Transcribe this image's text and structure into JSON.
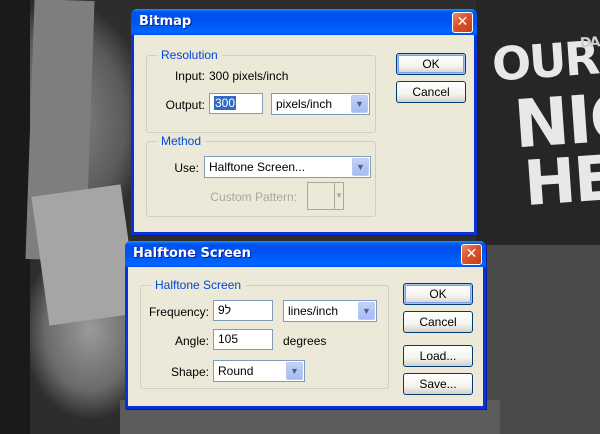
{
  "background": {
    "poster_text_1": "OUR",
    "poster_text_2": "NIG",
    "poster_text_3": "HE",
    "poster_text_4": "DA"
  },
  "bitmap": {
    "title": "Bitmap",
    "close_glyph": "✕",
    "resolution": {
      "legend": "Resolution",
      "input_label": "Input:",
      "input_value": "300 pixels/inch",
      "output_label": "Output:",
      "output_value": "300",
      "output_unit": "pixels/inch"
    },
    "method": {
      "legend": "Method",
      "use_label": "Use:",
      "use_value": "Halftone Screen...",
      "custom_pattern_label": "Custom Pattern:"
    },
    "ok_label": "OK",
    "cancel_label": "Cancel"
  },
  "halftone": {
    "title": "Halftone Screen",
    "close_glyph": "✕",
    "legend": "Halftone Screen",
    "frequency_label": "Frequency:",
    "frequency_value": "9ל",
    "frequency_unit": "lines/inch",
    "angle_label": "Angle:",
    "angle_value": "105",
    "angle_unit": "degrees",
    "shape_label": "Shape:",
    "shape_value": "Round",
    "ok_label": "OK",
    "cancel_label": "Cancel",
    "load_label": "Load...",
    "save_label": "Save..."
  },
  "colors": {
    "title_blue": "#0053ee",
    "legend_blue": "#0046d5",
    "dialog_face": "#ece9d8",
    "close_red": "#d9532c"
  }
}
